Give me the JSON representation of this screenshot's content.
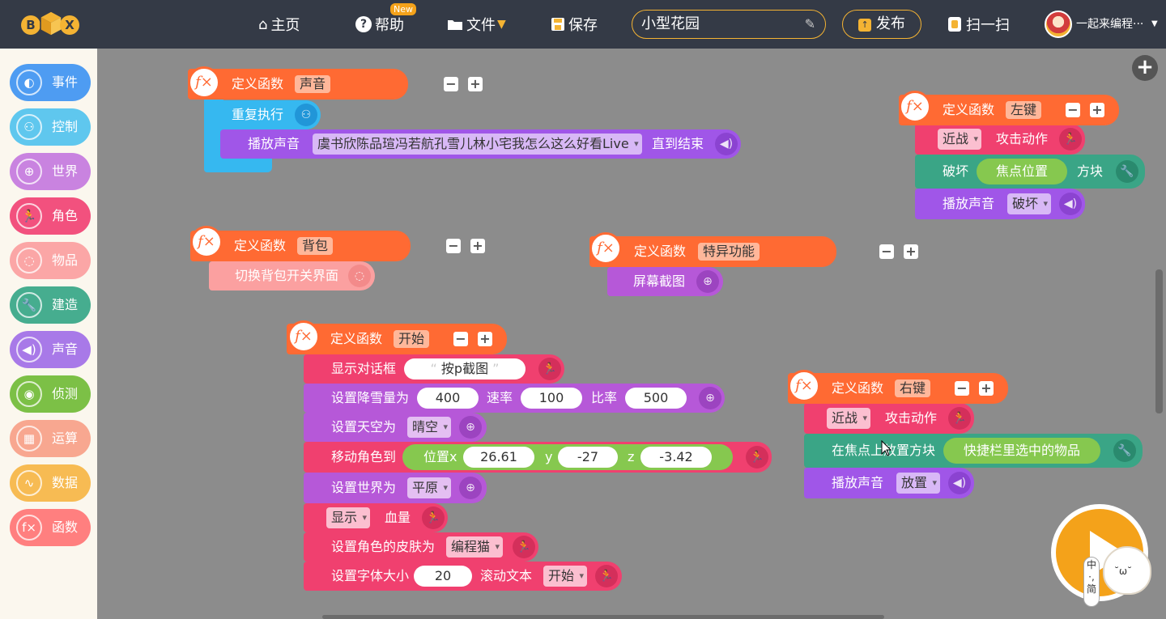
{
  "topbar": {
    "logo_letters": [
      "B",
      "X"
    ],
    "nav": {
      "home": "主页",
      "help": "帮助",
      "help_badge": "New",
      "file": "文件",
      "save": "保存",
      "publish": "发布",
      "scan": "扫一扫"
    },
    "project_name": "小型花园",
    "user_name": "一起来编程···"
  },
  "categories": [
    {
      "id": "event",
      "label": "事件",
      "color": "#4e9cf2",
      "icon": "toggle-icon"
    },
    {
      "id": "control",
      "label": "控制",
      "color": "#5fc7ee",
      "icon": "gamepad-icon"
    },
    {
      "id": "world",
      "label": "世界",
      "color": "#c983e0",
      "icon": "globe-icon"
    },
    {
      "id": "actor",
      "label": "角色",
      "color": "#f2517e",
      "icon": "runner-icon"
    },
    {
      "id": "item",
      "label": "物品",
      "color": "#fba6a6",
      "icon": "potion-icon"
    },
    {
      "id": "build",
      "label": "建造",
      "color": "#46ad8f",
      "icon": "wrench-icon"
    },
    {
      "id": "sound",
      "label": "声音",
      "color": "#a879e8",
      "icon": "speaker-icon"
    },
    {
      "id": "detect",
      "label": "侦测",
      "color": "#7cc046",
      "icon": "signal-icon"
    },
    {
      "id": "operator",
      "label": "运算",
      "color": "#f8a790",
      "icon": "calculator-icon"
    },
    {
      "id": "data",
      "label": "数据",
      "color": "#f7bb53",
      "icon": "chart-icon"
    },
    {
      "id": "function",
      "label": "函数",
      "color": "#ff7f7f",
      "icon": "fx-icon"
    }
  ],
  "blocks": {
    "define_label": "定义函数",
    "sound_func": {
      "name": "声音",
      "repeat": "重复执行",
      "play": "播放声音",
      "song": "虞书欣陈品瑄冯若航孔雪儿林小宅我怎么这么好看Live",
      "until_end": "直到结束"
    },
    "bag_func": {
      "name": "背包",
      "toggle": "切换背包开关界面"
    },
    "special_func": {
      "name": "特异功能",
      "screenshot": "屏幕截图"
    },
    "start_func": {
      "name": "开始",
      "show_dialog": "显示对话框",
      "dialog_text": "按p截图",
      "snow": "设置降雪量为",
      "snow_amount": "400",
      "rate_label": "速率",
      "rate": "100",
      "ratio_label": "比率",
      "ratio": "500",
      "sky": "设置天空为",
      "sky_value": "晴空",
      "move_to": "移动角色到",
      "position_x": "位置x",
      "x": "26.61",
      "y_label": "y",
      "y": "-27",
      "z_label": "z",
      "z": "-3.42",
      "set_world": "设置世界为",
      "world_value": "平原",
      "show_value": "显示",
      "hp": "血量",
      "skin": "设置角色的皮肤为",
      "skin_value": "编程猫",
      "font_size": "设置字体大小",
      "font_size_value": "20",
      "scroll_text": "滚动文本",
      "scroll_value": "开始"
    },
    "left_func": {
      "name": "左键",
      "melee": "近战",
      "attack": "攻击动作",
      "destroy": "破坏",
      "focus_pos": "焦点位置",
      "block": "方块",
      "play": "播放声音",
      "sound_value": "破坏"
    },
    "right_func": {
      "name": "右键",
      "melee": "近战",
      "attack": "攻击动作",
      "place_at": "在焦点上放置方块",
      "selected_item": "快捷栏里选中的物品",
      "play": "播放声音",
      "sound_value": "放置"
    }
  },
  "overlay": {
    "ime": [
      "中",
      "·,",
      "简"
    ]
  },
  "colors": {
    "topbar": "#343a46",
    "accent": "#f4b333",
    "define": "#ff6a33",
    "control": "#36b8f0",
    "sound": "#a056e8",
    "actor": "#f0406f",
    "world": "#b658d8",
    "build": "#3aa586",
    "detect": "#7cc046",
    "item": "#fba0a0",
    "workspace": "#8c8c8c"
  }
}
